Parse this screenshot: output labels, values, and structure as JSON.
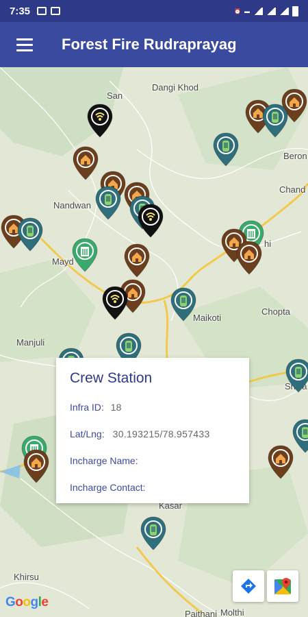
{
  "status_bar": {
    "time": "7:35"
  },
  "app_bar": {
    "title": "Forest Fire Rudraprayag"
  },
  "map": {
    "places": [
      {
        "id": "san",
        "name": "San"
      },
      {
        "id": "dangi",
        "name": "Dangi Khod"
      },
      {
        "id": "beron",
        "name": "Beron"
      },
      {
        "id": "chand",
        "name": "Chand"
      },
      {
        "id": "nandwan",
        "name": "Nandwan"
      },
      {
        "id": "may",
        "name": "Mayd"
      },
      {
        "id": "maikoti",
        "name": "Maikoti"
      },
      {
        "id": "chopta",
        "name": "Chopta"
      },
      {
        "id": "manjuli",
        "name": "Manjuli"
      },
      {
        "id": "shiva",
        "name": "Shiva"
      },
      {
        "id": "khirsu",
        "name": "Khirsu"
      },
      {
        "id": "paithani",
        "name": "Paithani"
      },
      {
        "id": "molthi",
        "name": "Molthi"
      },
      {
        "id": "ghi",
        "name": "hi"
      },
      {
        "id": "kasar",
        "name": "Kasar"
      }
    ],
    "colors": {
      "fire_station": "#6b3e1e",
      "water_tank": "#2f6f7b",
      "watchtower": "#111111",
      "crew_station": "#3aa96b",
      "road": "#f2c94c"
    }
  },
  "info_window": {
    "title": "Crew Station",
    "infra_id_label": "Infra ID:",
    "infra_id_value": "18",
    "latlng_label": "Lat/Lng:",
    "latlng_value": "30.193215/78.957433",
    "incharge_name_label": "Incharge Name:",
    "incharge_name_value": "",
    "incharge_contact_label": "Incharge Contact:",
    "incharge_contact_value": ""
  },
  "map_buttons": {
    "directions_icon": "directions-icon",
    "open_maps_icon": "google-maps-icon"
  },
  "attribution": {
    "brand": "Google"
  }
}
